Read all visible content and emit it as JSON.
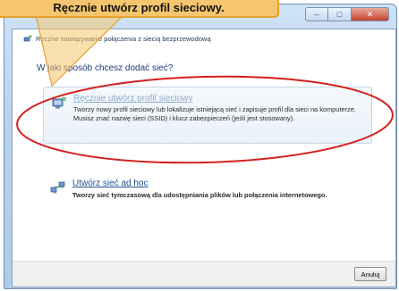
{
  "window": {
    "title": "Ręczne nawiązywanie połączenia z siecią bezprzewodową",
    "min_glyph": "–",
    "max_glyph": "□",
    "close_glyph": "✕"
  },
  "main": {
    "question": "W jaki sposób chcesz dodać sieć?",
    "options": [
      {
        "title": "Ręcznie utwórz profil sieciowy",
        "description": "Tworzy nowy profil sieciowy lub lokalizuje istniejącą sieć i zapisuje profil dla sieci na komputerze. Musisz znać nazwę sieci (SSID) i klucz zabezpieczeń (jeśli jest stosowany).",
        "icon": "network-computer-icon"
      },
      {
        "title": "Utwórz sieć ad hoc",
        "description": "Tworzy sieć tymczasową dla udostępniania plików lub połączenia internetowego.",
        "icon": "adhoc-network-icon"
      }
    ]
  },
  "footer": {
    "cancel_label": "Anuluj"
  },
  "callout": {
    "text": "Ręcznie utwórz profil sieciowy."
  },
  "colors": {
    "callout_fill": "#f6c66e",
    "highlight_ring": "#d42020",
    "link": "#1f4f94"
  }
}
